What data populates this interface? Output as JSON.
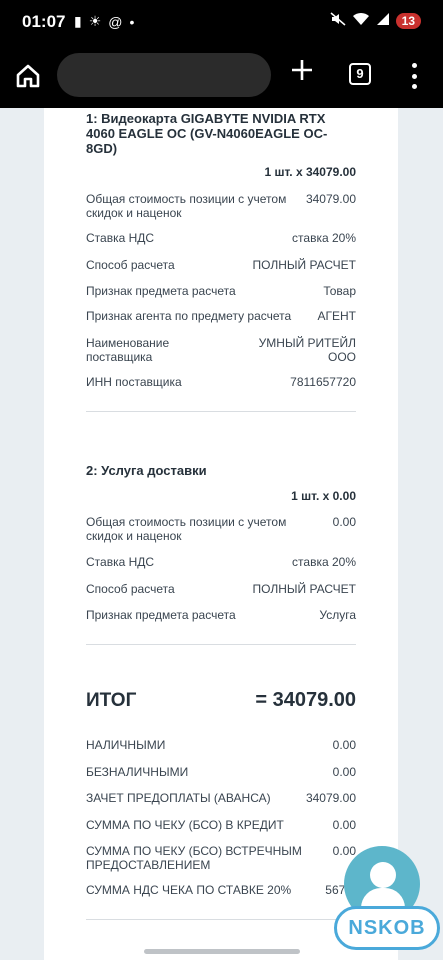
{
  "status_bar": {
    "time": "01:07",
    "left_icons": [
      "battery-saver-icon",
      "brightness-icon",
      "at-icon",
      "dot-icon"
    ],
    "right_icons": [
      "mute-icon",
      "wifi-icon",
      "signal-icon"
    ],
    "battery": "13"
  },
  "browser": {
    "tabs_count": "9",
    "icons": {
      "home": "home-icon",
      "new_tab": "plus-icon",
      "menu": "more-vert-icon"
    }
  },
  "receipt": {
    "items": [
      {
        "title": "1: Видеокарта GIGABYTE NVIDIA RTX 4060 EAGLE OC (GV-N4060EAGLE OC-8GD)",
        "qty": "1 шт. x 34079.00",
        "rows": [
          {
            "label": "Общая стоимость позиции с учетом скидок и наценок",
            "value": "34079.00"
          },
          {
            "label": "Ставка НДС",
            "value": "ставка 20%"
          },
          {
            "label": "Способ расчета",
            "value": "ПОЛНЫЙ РАСЧЕТ"
          },
          {
            "label": "Признак предмета расчета",
            "value": "Товар"
          },
          {
            "label": "Признак агента по предмету расчета",
            "value": "АГЕНТ"
          },
          {
            "label": "Наименование поставщика",
            "value": "УМНЫЙ РИТЕЙЛ ООО"
          },
          {
            "label": "ИНН поставщика",
            "value": "7811657720"
          }
        ]
      },
      {
        "title": "2: Услуга доставки",
        "qty": "1 шт. x 0.00",
        "rows": [
          {
            "label": "Общая стоимость позиции с учетом скидок и наценок",
            "value": "0.00"
          },
          {
            "label": "Ставка НДС",
            "value": "ставка 20%"
          },
          {
            "label": "Способ расчета",
            "value": "ПОЛНЫЙ РАСЧЕТ"
          },
          {
            "label": "Признак предмета расчета",
            "value": "Услуга"
          }
        ]
      }
    ],
    "total_label": "ИТОГ",
    "total_value": "= 34079.00",
    "summary": [
      {
        "label": "НАЛИЧНЫМИ",
        "value": "0.00"
      },
      {
        "label": "БЕЗНАЛИЧНЫМИ",
        "value": "0.00"
      },
      {
        "label": "ЗАЧЕТ ПРЕДОПЛАТЫ (АВАНСА)",
        "value": "34079.00"
      },
      {
        "label": "СУММА ПО ЧЕКУ (БСО) В КРЕДИТ",
        "value": "0.00"
      },
      {
        "label": "СУММА ПО ЧЕКУ (БСО) ВСТРЕЧНЫМ ПРЕДОСТАВЛЕНИЕМ",
        "value": "0.00"
      },
      {
        "label": "СУММА НДС ЧЕКА ПО СТАВКЕ 20%",
        "value": "5679.8"
      }
    ]
  },
  "overlay": {
    "watermark": "NSKOB",
    "chat_icon": "person-chat-icon"
  }
}
